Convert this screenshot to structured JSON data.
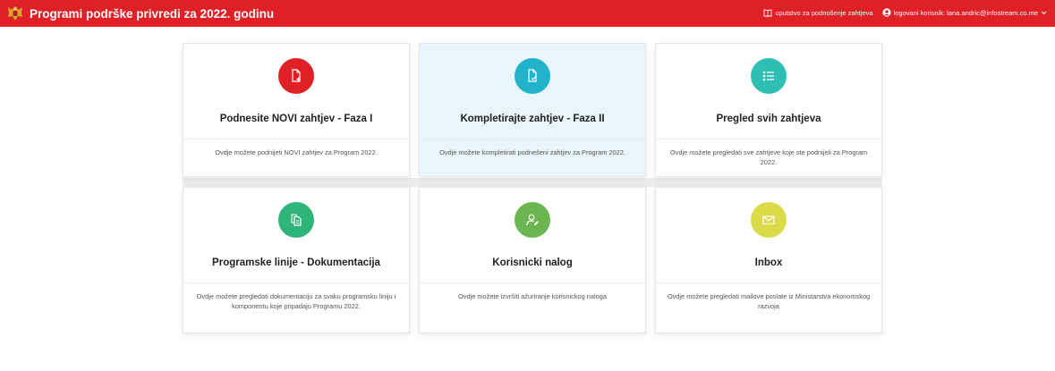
{
  "header": {
    "title": "Programi podrške privredi za 2022. godinu",
    "guide_label": "uputstvo za podnošenje zahtjeva",
    "user_label": "logovani korisnik: lana.andric@infostream.co.me"
  },
  "colors": {
    "topbar": "#e02027",
    "card_new": "#e02027",
    "card_complete": "#21b3cb",
    "card_list": "#2fbfb2",
    "card_docs": "#2fb57a",
    "card_account": "#6cb652",
    "card_inbox": "#dbdb4a"
  },
  "cards": [
    {
      "title": "Podnesite NOVI zahtjev - Faza I",
      "description": "Ovdje možete podnijeti NOVI zahtjev za Program 2022.",
      "icon": "file-plus-icon"
    },
    {
      "title": "Kompletirajte zahtjev - Faza II",
      "description": "Ovdje možete kompletirati podnešeni zahtjev za Program 2022.",
      "icon": "file-check-icon"
    },
    {
      "title": "Pregled svih zahtjeva",
      "description": "Ovdje možete pregledati sve zahtjeve koje ste podnijeli za Program 2022.",
      "icon": "list-icon"
    },
    {
      "title": "Programske linije - Dokumentacija",
      "description": "Ovdje možete pregledati dokumentaciju za svaku programsku liniju i komponentu koje pripadaju Programu 2022.",
      "icon": "documents-icon"
    },
    {
      "title": "Korisnicki nalog",
      "description": "Ovdje možete izvršiti ažuriranje korisnickog naloga",
      "icon": "user-edit-icon"
    },
    {
      "title": "Inbox",
      "description": "Ovdje možete pregledati mailove poslate iz Ministarstva ekonomskog razvoja",
      "icon": "envelope-icon"
    }
  ]
}
